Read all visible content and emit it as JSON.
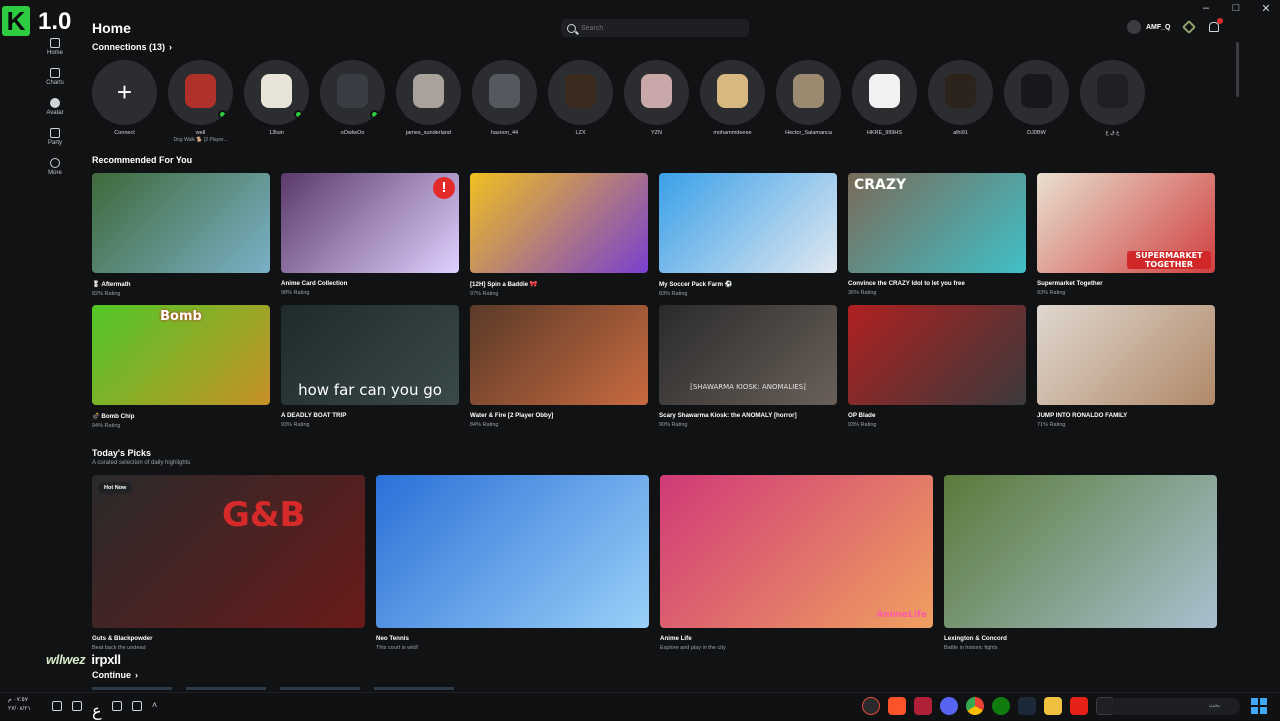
{
  "window": {
    "minimize": "–",
    "maximize": "□",
    "close": "✕"
  },
  "logo": {
    "letter": "K",
    "version": "1.0"
  },
  "rail": [
    {
      "label": "Home",
      "icon": "home-icon"
    },
    {
      "label": "Charts",
      "icon": "charts-icon"
    },
    {
      "label": "Avatar",
      "icon": "avatar-icon"
    },
    {
      "label": "Party",
      "icon": "party-icon"
    },
    {
      "label": "More",
      "icon": "more-icon"
    }
  ],
  "header": {
    "title": "Home",
    "search_placeholder": "Search",
    "username": "AMF_Q"
  },
  "connections": {
    "heading": "Connections (13)",
    "add_label": "Connect",
    "items": [
      {
        "name": "well",
        "status": "Dog Walk 🐕 [2 Player...",
        "online": true,
        "color": "#b0302a"
      },
      {
        "name": "13luin",
        "status": "",
        "online": true,
        "color": "#e8e4d8"
      },
      {
        "name": "oOwlwOo",
        "status": "",
        "online": true,
        "color": "#3a3d44"
      },
      {
        "name": "james_sunderland",
        "status": "",
        "online": false,
        "color": "#a9a29a"
      },
      {
        "name": "hasoon_44",
        "status": "",
        "online": false,
        "color": "#55585e"
      },
      {
        "name": "LZX",
        "status": "",
        "online": false,
        "color": "#3b2a1e"
      },
      {
        "name": "YZN",
        "status": "",
        "online": false,
        "color": "#c8a8a8"
      },
      {
        "name": "mohammdeeee",
        "status": "",
        "online": false,
        "color": "#d8b880"
      },
      {
        "name": "Hector_Salamanca",
        "status": "",
        "online": false,
        "color": "#9b8a70"
      },
      {
        "name": "HKRE_999HS",
        "status": "",
        "online": false,
        "color": "#f2f2f2"
      },
      {
        "name": "alhi91",
        "status": "",
        "online": false,
        "color": "#2c241c"
      },
      {
        "name": "DJ0BW",
        "status": "",
        "online": false,
        "color": "#18181c"
      },
      {
        "name": "ع ق غ",
        "status": "",
        "online": false,
        "color": "#202024"
      }
    ]
  },
  "recommended": {
    "heading": "Recommended For You",
    "row1": [
      {
        "name": "🎖 Aftermath",
        "rating": "82% Rating",
        "bg": "#3f6a3a",
        "bg2": "#7ab0c8"
      },
      {
        "name": "Anime Card Collection",
        "rating": "98% Rating",
        "bg": "#5a3a6a",
        "bg2": "#e0d0ff",
        "badge": "!"
      },
      {
        "name": "[12H] Spin a Baddie 🎀",
        "rating": "97% Rating",
        "bg": "#f0c020",
        "bg2": "#7a3fd0"
      },
      {
        "name": "My Soccer Pack Farm ⚽",
        "rating": "83% Rating",
        "bg": "#3aa0e8",
        "bg2": "#e0e8f0"
      },
      {
        "name": "Convince the CRAZY Idol to let you free",
        "rating": "36% Rating",
        "bg": "#7a6a58",
        "bg2": "#40c0c8",
        "text": "CRAZY"
      },
      {
        "name": "Supermarket Together",
        "rating": "93% Rating",
        "bg": "#e8e0d0",
        "bg2": "#d04040",
        "text": "SUPERMARKET TOGETHER"
      }
    ],
    "row2": [
      {
        "name": "💣 Bomb Chip",
        "rating": "94% Rating",
        "bg": "#50c828",
        "bg2": "#c89028",
        "text": "Bomb"
      },
      {
        "name": "A DEADLY BOAT TRIP",
        "rating": "93% Rating",
        "bg": "#1e2a2c",
        "bg2": "#3a4a48",
        "text": "how far can you go"
      },
      {
        "name": "Water & Fire [2 Player Obby]",
        "rating": "84% Rating",
        "bg": "#5a3a28",
        "bg2": "#c86a40"
      },
      {
        "name": "Scary Shawarma Kiosk: the ANOMALY [horror]",
        "rating": "90% Rating",
        "bg": "#2a2a2c",
        "bg2": "#6a6058",
        "text": "[SHAWARMA KIOSK: ANOMALIES]"
      },
      {
        "name": "OP Blade",
        "rating": "93% Rating",
        "bg": "#b02020",
        "bg2": "#3a3a3c"
      },
      {
        "name": "JUMP INTO RONALDO FAMILY",
        "rating": "71% Rating",
        "bg": "#e0d8d0",
        "bg2": "#b08868"
      }
    ]
  },
  "picks": {
    "heading": "Today's Picks",
    "subheading": "A curated selection of daily highlights",
    "items": [
      {
        "name": "Guts & Blackpowder",
        "desc": "Beat back the undead",
        "bg": "#2a2a2a",
        "bg2": "#6a1a1a",
        "badge": "Hot Now",
        "text": "G&B"
      },
      {
        "name": "Neo Tennis",
        "desc": "This court is wild!",
        "bg": "#2a70d8",
        "bg2": "#9ad0f8"
      },
      {
        "name": "Anime Life",
        "desc": "Explore and play in the city",
        "bg": "#d03a78",
        "bg2": "#f0a060",
        "text": "AnimeLife"
      },
      {
        "name": "Lexington & Concord",
        "desc": "Battle in historic fights",
        "bg": "#5a7a3a",
        "bg2": "#a8c0d0"
      }
    ]
  },
  "continue": {
    "heading": "Continue"
  },
  "overlay": {
    "tag": "wllwez",
    "tag2": "irpxll"
  },
  "taskbar": {
    "time": "٠٧:٥٧ م",
    "date": "٢٧/٠٨/٢١",
    "lang": "ع",
    "search_placeholder": "بحث"
  }
}
